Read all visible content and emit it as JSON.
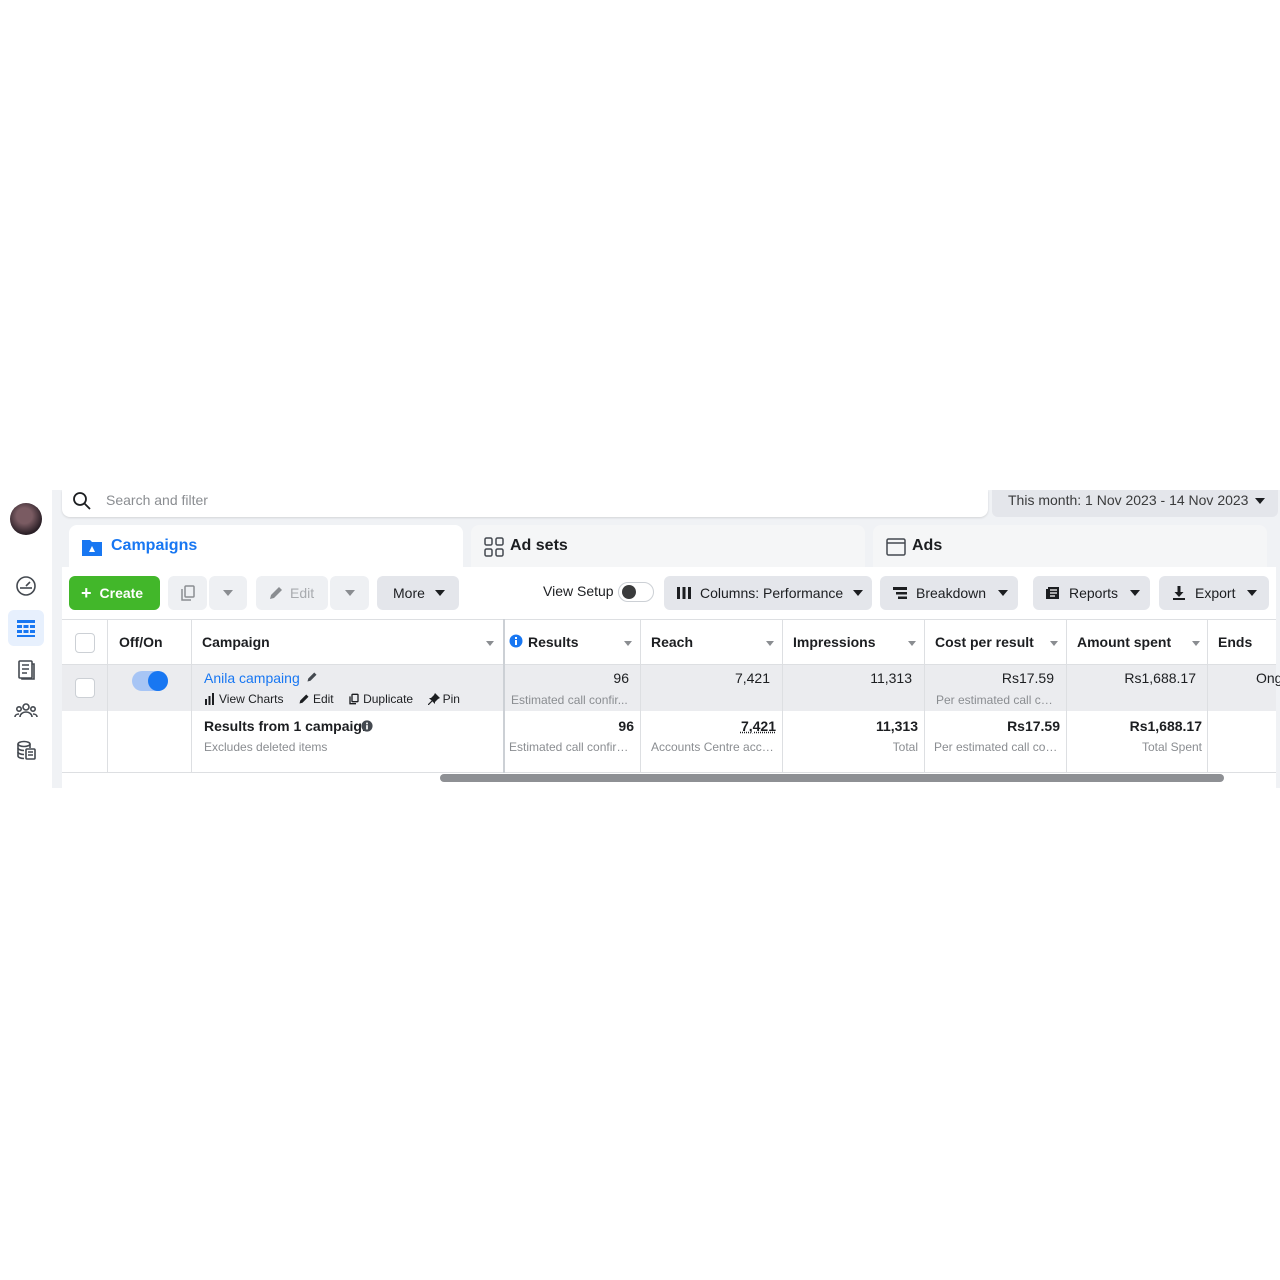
{
  "search": {
    "placeholder": "Search and filter"
  },
  "date_range": {
    "label": "This month: 1 Nov 2023 - 14 Nov 2023"
  },
  "tabs": [
    {
      "label": "Campaigns",
      "active": true
    },
    {
      "label": "Ad sets",
      "active": false
    },
    {
      "label": "Ads",
      "active": false
    }
  ],
  "toolbar": {
    "create_label": "Create",
    "edit_label": "Edit",
    "more_label": "More",
    "view_setup_label": "View Setup",
    "columns_label": "Columns: Performance",
    "breakdown_label": "Breakdown",
    "reports_label": "Reports",
    "export_label": "Export"
  },
  "table": {
    "headers": {
      "offon": "Off/On",
      "campaign": "Campaign",
      "results": "Results",
      "reach": "Reach",
      "impressions": "Impressions",
      "cost_per_result": "Cost per result",
      "amount_spent": "Amount spent",
      "ends": "Ends"
    },
    "row": {
      "name": "Anila campaing",
      "actions": {
        "view_charts": "View Charts",
        "edit": "Edit",
        "duplicate": "Duplicate",
        "pin": "Pin"
      },
      "results": "96",
      "results_sub": "Estimated call confir...",
      "reach": "7,421",
      "impressions": "11,313",
      "cost_per_result": "Rs17.59",
      "cost_sub": "Per estimated call co...",
      "amount_spent": "Rs1,688.17",
      "ends": "Ong"
    },
    "summary": {
      "title": "Results from 1 campaign",
      "subtitle": "Excludes deleted items",
      "results": "96",
      "results_sub": "Estimated call confirm...",
      "reach": "7,421",
      "reach_sub": "Accounts Centre acco...",
      "impressions": "11,313",
      "impressions_sub": "Total",
      "cost_per_result": "Rs17.59",
      "cost_sub": "Per estimated call con...",
      "amount_spent": "Rs1,688.17",
      "amount_sub": "Total Spent"
    }
  },
  "colors": {
    "brand_blue": "#1877f2",
    "create_green": "#42b72a"
  }
}
